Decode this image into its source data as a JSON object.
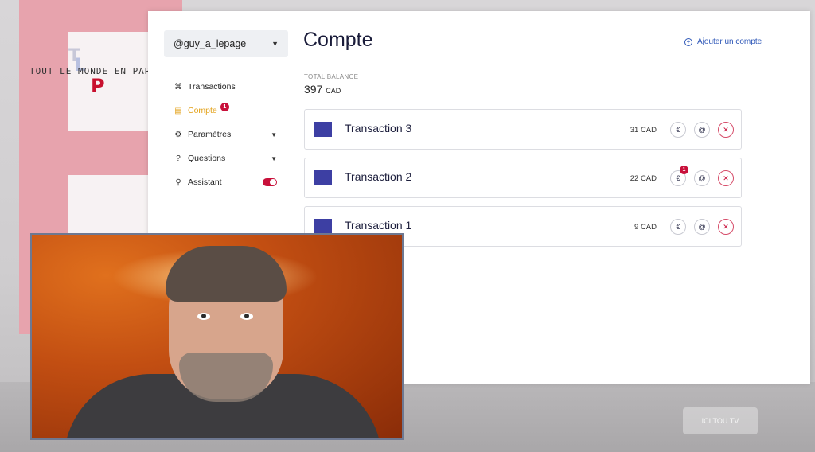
{
  "show": {
    "logo_text": "TOUT LE MONDE EN PARLE",
    "watermark": "ICI TOU.TV"
  },
  "sidebar": {
    "account_selected": "@guy_a_lepage",
    "items": [
      {
        "label": "Transactions",
        "icon": "command-icon"
      },
      {
        "label": "Compte",
        "icon": "card-icon",
        "active": true,
        "badge": "1"
      },
      {
        "label": "Paramètres",
        "icon": "gear-icon",
        "expandable": true
      },
      {
        "label": "Questions",
        "icon": "question-icon",
        "expandable": true
      },
      {
        "label": "Assistant",
        "icon": "flask-icon",
        "toggle_on": true
      }
    ]
  },
  "main": {
    "title": "Compte",
    "add_account_label": "Ajouter un compte",
    "balance_label": "TOTAL BALANCE",
    "balance_amount": "397",
    "balance_unit": "CAD",
    "transactions": [
      {
        "name": "Transaction 3",
        "amount": "31 CAD",
        "badge": ""
      },
      {
        "name": "Transaction 2",
        "amount": "22 CAD",
        "badge": "1"
      },
      {
        "name": "Transaction 1",
        "amount": "9 CAD",
        "badge": ""
      }
    ]
  },
  "colors": {
    "accent_active": "#e3a21a",
    "badge": "#c8103a",
    "link": "#2f58b8",
    "thumb": "#3d3fa3"
  }
}
